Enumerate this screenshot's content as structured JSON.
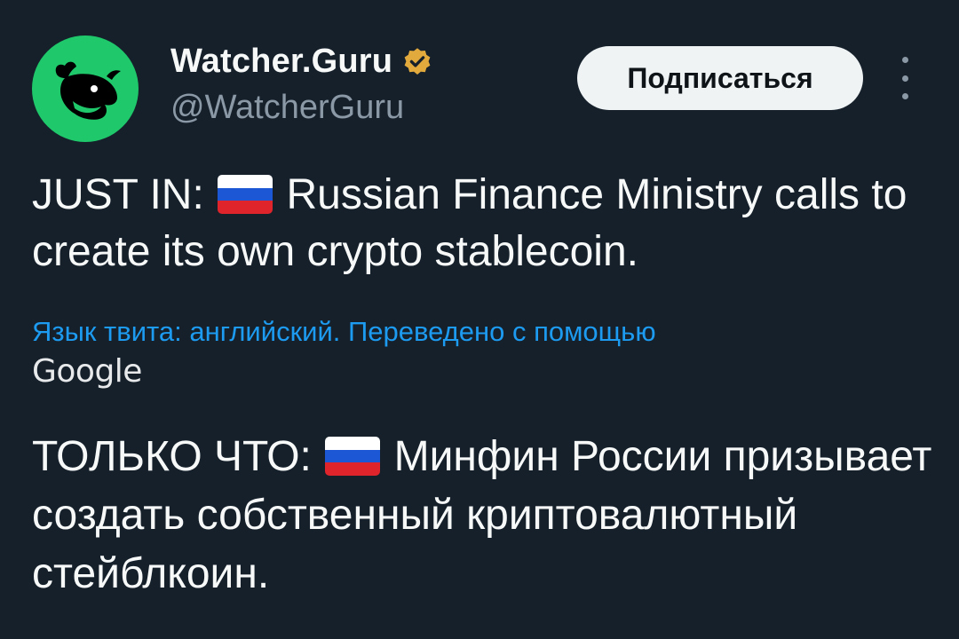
{
  "author": {
    "name": "Watcher.Guru",
    "handle": "@WatcherGuru",
    "avatar_icon": "whale-logo",
    "verified_icon": "gold-verified-badge",
    "avatar_color": "#1fc96b"
  },
  "actions": {
    "follow_label": "Подписаться",
    "more_icon": "vertical-ellipsis"
  },
  "tweet": {
    "prefix": "JUST IN:",
    "flag": "russia-flag",
    "text": "Russian Finance Ministry calls to create its own crypto stablecoin."
  },
  "translation": {
    "note": "Язык твита: английский. Переведено с помощью",
    "provider": "Google",
    "prefix": "ТОЛЬКО ЧТО:",
    "flag": "russia-flag",
    "text": "Минфин России призывает создать собственный криптовалютный стейблкоин."
  },
  "colors": {
    "background": "#15202b",
    "link": "#1d9bf0",
    "secondary_text": "#8b98a5",
    "verified": "#e2a93c"
  }
}
